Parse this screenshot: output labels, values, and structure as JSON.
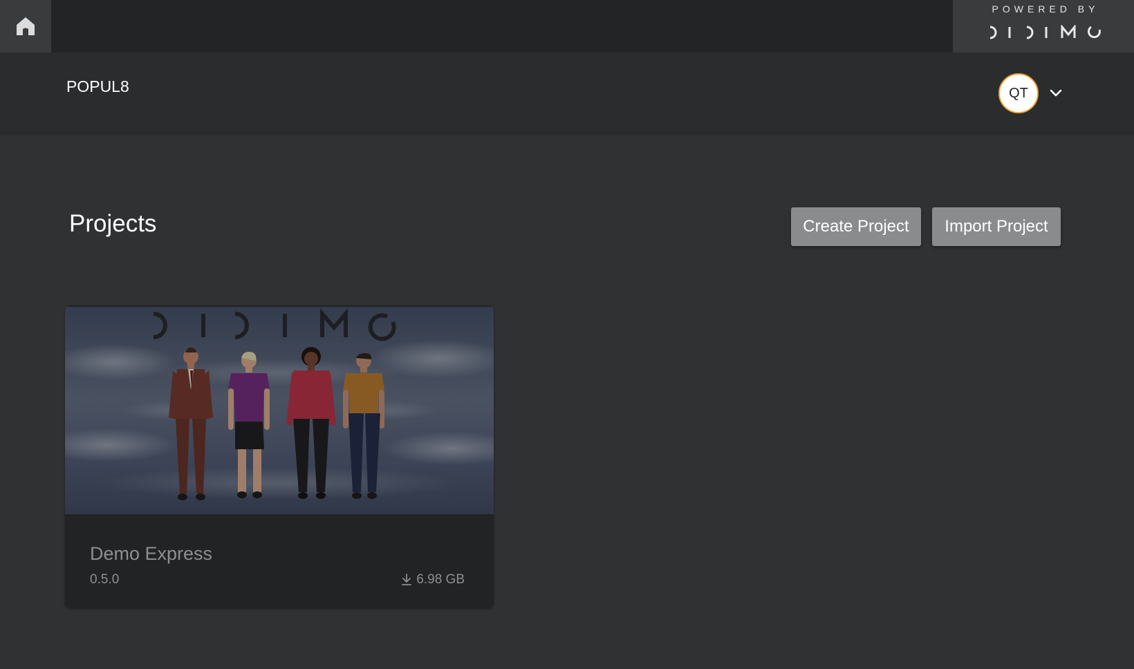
{
  "topbar": {
    "home_icon": "home-icon",
    "powered_by": "POWERED BY",
    "brand_logo": "DIDIMO"
  },
  "header": {
    "app_name": "POPUL8",
    "user_initials": "QT",
    "user_menu_icon": "chevron-down-icon"
  },
  "main": {
    "title": "Projects",
    "create_label": "Create Project",
    "import_label": "Import Project"
  },
  "projects": [
    {
      "name": "Demo Express",
      "version": "0.5.0",
      "size": "6.98 GB",
      "size_icon": "download-icon",
      "thumbnail_logo": "DIDIMO"
    }
  ],
  "colors": {
    "background": "#303133",
    "topbar": "#232425",
    "header": "#2b2c2e",
    "button": "#8a8b8d",
    "avatar_ring": "#f0a535",
    "card": "#222324"
  }
}
